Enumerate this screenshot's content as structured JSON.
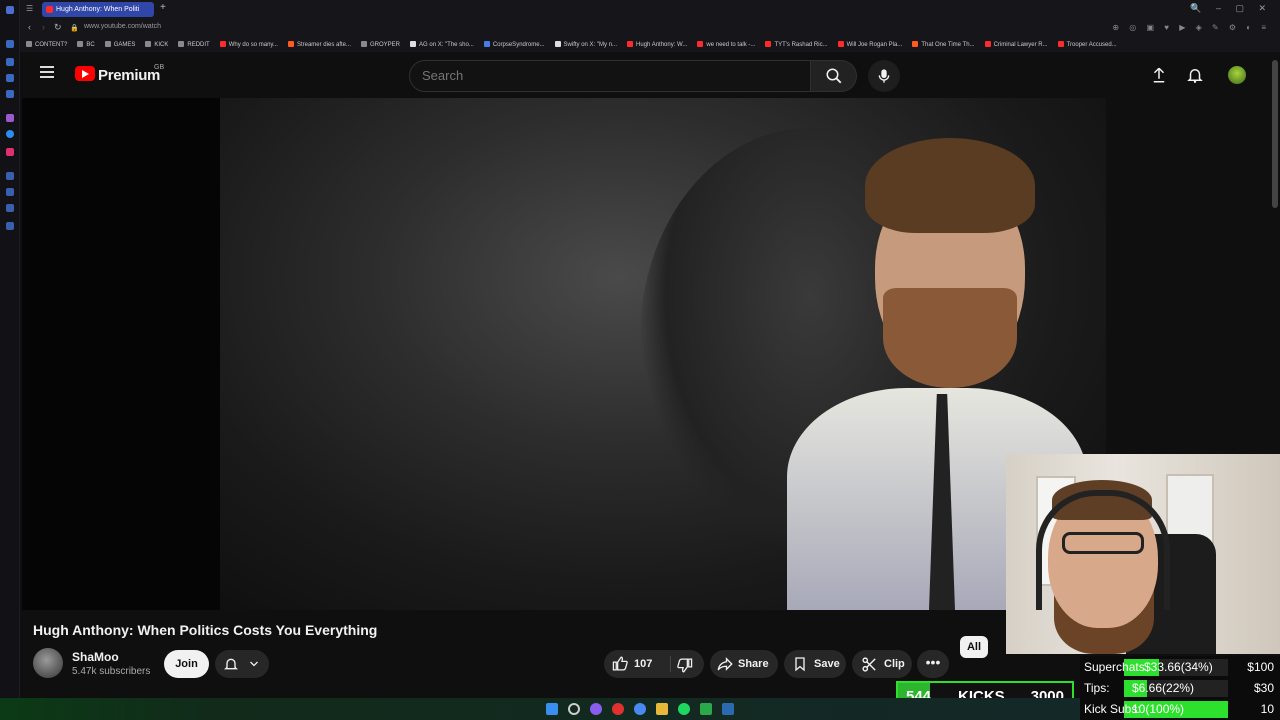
{
  "browser": {
    "active_tab": "Hugh Anthony: When Politi",
    "new_tab": "+",
    "url": "www.youtube.com/watch",
    "bookmarks": [
      {
        "label": "CONTENT?",
        "color": "#8a8a8a"
      },
      {
        "label": "BC",
        "color": "#8a8a8a"
      },
      {
        "label": "GAMES",
        "color": "#8a8a8a"
      },
      {
        "label": "KICK",
        "color": "#8a8a8a"
      },
      {
        "label": "REDDIT",
        "color": "#8a8a8a"
      },
      {
        "label": "Why do so many...",
        "color": "#ff2b2b"
      },
      {
        "label": "Streamer dies afte...",
        "color": "#ff5a1f"
      },
      {
        "label": "GROYPER",
        "color": "#8a8a8a"
      },
      {
        "label": "AG on X: \"The sho...",
        "color": "#dddddd"
      },
      {
        "label": "CorpseSyndrome...",
        "color": "#4a7ae8"
      },
      {
        "label": "Swifty on X: \"My n...",
        "color": "#dddddd"
      },
      {
        "label": "Hugh Anthony: W...",
        "color": "#ff2b2b"
      },
      {
        "label": "we need to talk -...",
        "color": "#ff2b2b"
      },
      {
        "label": "TYT's Rashad Ric...",
        "color": "#ff2b2b"
      },
      {
        "label": "Will Joe Rogan Pla...",
        "color": "#ff2b2b"
      },
      {
        "label": "That One Time Th...",
        "color": "#ff5a1f"
      },
      {
        "label": "Criminal Lawyer R...",
        "color": "#ff2b2b"
      },
      {
        "label": "Trooper Accused...",
        "color": "#ff2b2b"
      }
    ]
  },
  "youtube": {
    "brand": "Premium",
    "region": "GB",
    "search_placeholder": "Search",
    "accent": "#ff0000"
  },
  "video": {
    "title": "Hugh Anthony: When Politics Costs You Everything",
    "channel": "ShaMoo",
    "subscribers": "5.47k subscribers",
    "join_label": "Join",
    "likes": "107",
    "share_label": "Share",
    "save_label": "Save",
    "clip_label": "Clip",
    "more_label": "•••",
    "chip_all": "All"
  },
  "overlay": {
    "kicks_count": "544",
    "kicks_label": "KICKS",
    "kicks_goal": "3000",
    "goals": [
      {
        "label": "Superchats",
        "value": "$33.66(34%)",
        "target": "$100",
        "fraction": 0.34
      },
      {
        "label": "Tips:",
        "value": "$6.66(22%)",
        "target": "$30",
        "fraction": 0.22
      },
      {
        "label": "Kick Subs:",
        "value": "10(100%)",
        "target": "10",
        "fraction": 1.0
      }
    ],
    "accent": "#2de02d"
  }
}
